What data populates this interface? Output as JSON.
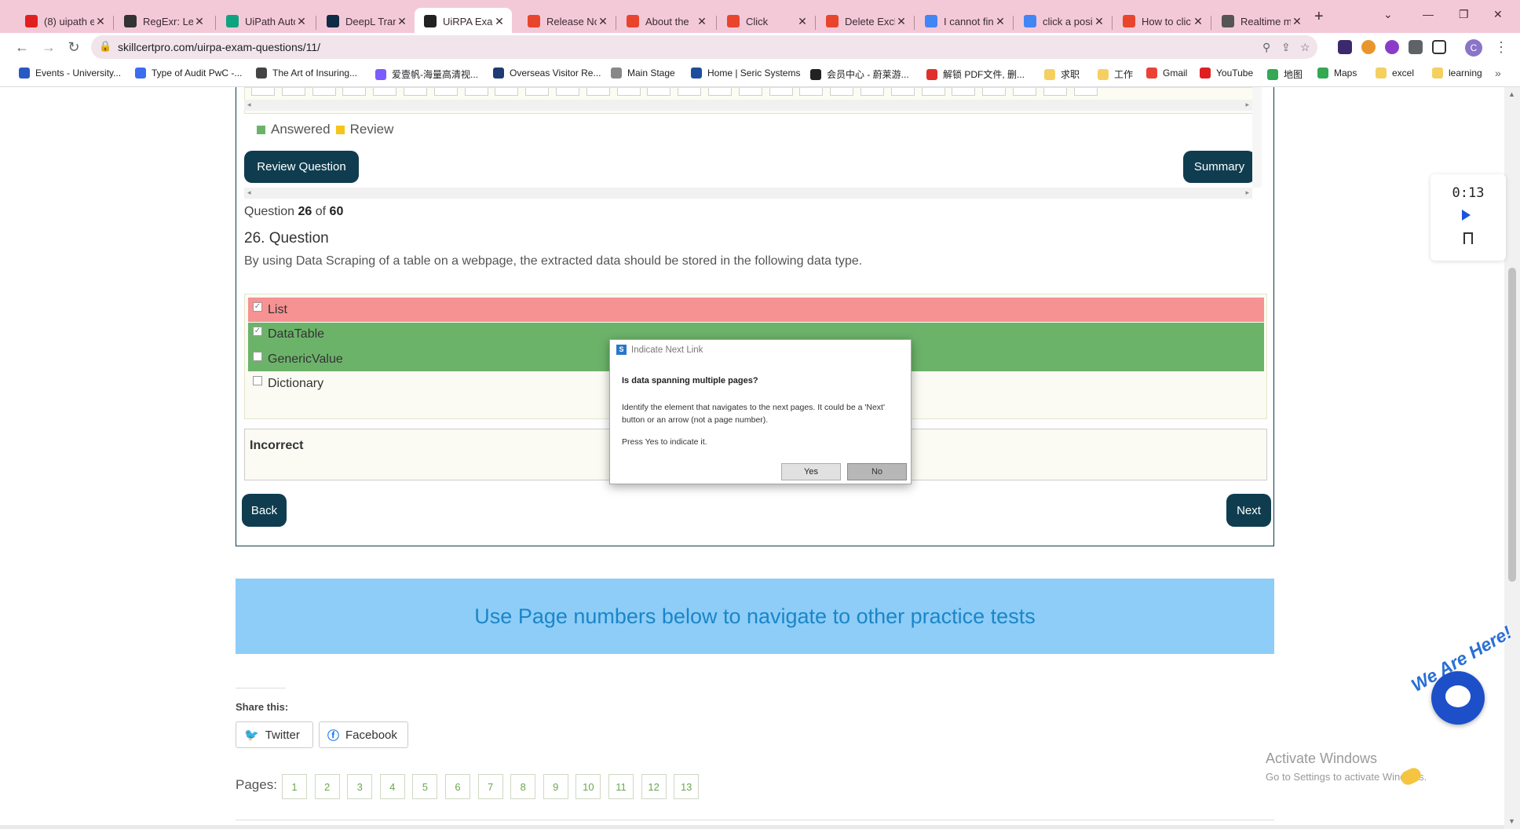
{
  "browser": {
    "tabs": [
      {
        "title": "(8) uipath e",
        "icon": "youtube-icon",
        "color": "#e02020"
      },
      {
        "title": "RegExr: Lea",
        "icon": "regexr-icon",
        "color": "#333333"
      },
      {
        "title": "UiPath Auto",
        "icon": "chatgpt-icon",
        "color": "#10a37f"
      },
      {
        "title": "DeepL Trans",
        "icon": "deepl-icon",
        "color": "#0f2b46"
      },
      {
        "title": "UiRPA Exam",
        "icon": "site-icon",
        "color": "#222222",
        "active": true
      },
      {
        "title": "Release No",
        "icon": "uipath-icon",
        "color": "#e8452c"
      },
      {
        "title": "About the",
        "icon": "uipath-icon",
        "color": "#e8452c"
      },
      {
        "title": "Click",
        "icon": "uipath-icon",
        "color": "#e8452c"
      },
      {
        "title": "Delete Exch",
        "icon": "uipath-icon",
        "color": "#e8452c"
      },
      {
        "title": "I cannot fin",
        "icon": "google-icon",
        "color": "#4285f4"
      },
      {
        "title": "click a posi",
        "icon": "google-icon",
        "color": "#4285f4"
      },
      {
        "title": "How to clic",
        "icon": "uipath-icon",
        "color": "#e8452c"
      },
      {
        "title": "Realtime m",
        "icon": "globe-icon",
        "color": "#555555"
      }
    ],
    "url": "skillcertpro.com/uirpa-exam-questions/11/",
    "bookmarks": [
      {
        "label": "Events - University...",
        "color": "#2b59c3"
      },
      {
        "label": "Type of Audit PwC -...",
        "color": "#3c6df0"
      },
      {
        "label": "The Art of Insuring...",
        "color": "#444444"
      },
      {
        "label": "爱壹帆-海量高清视...",
        "color": "#7a5cff"
      },
      {
        "label": "Overseas Visitor Re...",
        "color": "#1f3b73"
      },
      {
        "label": "Main Stage",
        "color": "#888888"
      },
      {
        "label": "Home | Seric Systems",
        "color": "#1d4e9b"
      },
      {
        "label": "会员中心 - 蔚莱游...",
        "color": "#222222"
      },
      {
        "label": "解锁 PDF文件, 删...",
        "color": "#e0302b"
      },
      {
        "label": "求职",
        "color": "#f5d061"
      },
      {
        "label": "工作",
        "color": "#f5d061"
      },
      {
        "label": "Gmail",
        "color": "#ea4335"
      },
      {
        "label": "YouTube",
        "color": "#e02020"
      },
      {
        "label": "地图",
        "color": "#34a853"
      },
      {
        "label": "Maps",
        "color": "#34a853"
      },
      {
        "label": "excel",
        "color": "#f5d061"
      },
      {
        "label": "learning",
        "color": "#f5d061"
      }
    ],
    "more_bookmarks": "»",
    "profile_initial": "C"
  },
  "quiz": {
    "legend_answered": "Answered",
    "legend_review": "Review",
    "review_button": "Review Question",
    "summary_button": "Summary",
    "counter_prefix": "Question",
    "current": "26",
    "counter_of": "of",
    "total": "60",
    "question_title": "26. Question",
    "question_text": "By using Data Scraping of a table on a webpage, the extracted data should be stored in the following data type.",
    "options": [
      {
        "label": "List",
        "checked": true,
        "state": "wrong"
      },
      {
        "label": "DataTable",
        "checked": true,
        "state": "correct"
      },
      {
        "label": "GenericValue",
        "checked": false,
        "state": "correct"
      },
      {
        "label": "Dictionary",
        "checked": false,
        "state": "none"
      }
    ],
    "feedback": "Incorrect",
    "back_button": "Back",
    "next_button": "Next"
  },
  "banner": "Use Page numbers below to navigate to other practice tests",
  "share": {
    "label": "Share this:",
    "twitter": "Twitter",
    "facebook": "Facebook"
  },
  "pages": {
    "label": "Pages:",
    "numbers": [
      "1",
      "2",
      "3",
      "4",
      "5",
      "6",
      "7",
      "8",
      "9",
      "10",
      "11",
      "12",
      "13"
    ]
  },
  "timer": "0:13",
  "windows_watermark": {
    "line1": "Activate Windows",
    "line2": "Go to Settings to activate Windows."
  },
  "chat_widget_text": "We Are Here!",
  "dialog": {
    "title": "Indicate Next Link",
    "heading": "Is data spanning multiple pages?",
    "body": "Identify the element that navigates to the next pages. It could be a 'Next' button or an arrow (not a page number).",
    "hint": "Press Yes to indicate it.",
    "yes": "Yes",
    "no": "No"
  },
  "colors": {
    "dark_teal": "#0f3d4f",
    "answered_green": "#6cb36a",
    "review_yellow": "#f5c518",
    "wrong_red": "#f79292",
    "banner_blue": "#8ecdf7",
    "banner_text": "#1a86c8"
  }
}
